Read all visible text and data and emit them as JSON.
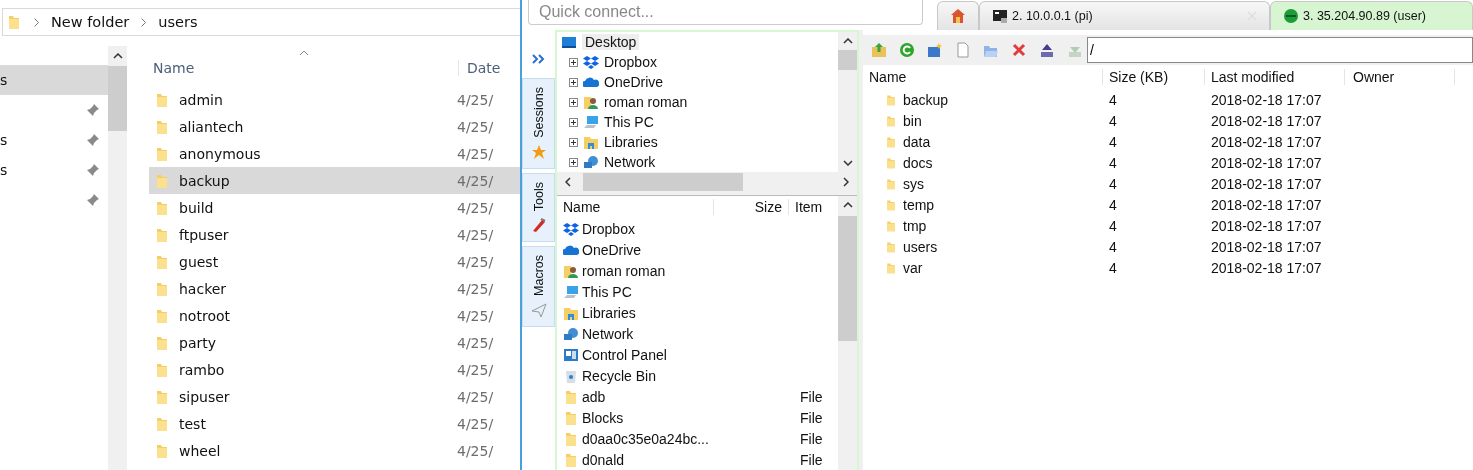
{
  "explorer": {
    "breadcrumb": [
      "New folder",
      "users"
    ],
    "nav_items": [
      {
        "label": "s",
        "selected": true,
        "pinned": false
      },
      {
        "selected": false,
        "pinned": true
      },
      {
        "label": "s",
        "selected": false,
        "pinned": true
      },
      {
        "label": "s",
        "selected": false,
        "pinned": true
      },
      {
        "selected": false,
        "pinned": true
      }
    ],
    "columns": [
      "Name",
      "Date"
    ],
    "rows": [
      {
        "name": "admin",
        "date": "4/25/",
        "selected": false
      },
      {
        "name": "aliantech",
        "date": "4/25/",
        "selected": false
      },
      {
        "name": "anonymous",
        "date": "4/25/",
        "selected": false
      },
      {
        "name": "backup",
        "date": "4/25/",
        "selected": true
      },
      {
        "name": "build",
        "date": "4/25/",
        "selected": false
      },
      {
        "name": "ftpuser",
        "date": "4/25/",
        "selected": false
      },
      {
        "name": "guest",
        "date": "4/25/",
        "selected": false
      },
      {
        "name": "hacker",
        "date": "4/25/",
        "selected": false
      },
      {
        "name": "notroot",
        "date": "4/25/",
        "selected": false
      },
      {
        "name": "party",
        "date": "4/25/",
        "selected": false
      },
      {
        "name": "rambo",
        "date": "4/25/",
        "selected": false
      },
      {
        "name": "sipuser",
        "date": "4/25/",
        "selected": false
      },
      {
        "name": "test",
        "date": "4/25/",
        "selected": false
      },
      {
        "name": "wheel",
        "date": "4/25/",
        "selected": false
      }
    ]
  },
  "mobaxterm": {
    "quick_connect": {
      "placeholder": "Quick connect..."
    },
    "tabs": [
      {
        "kind": "home",
        "selected": false,
        "closable": false
      },
      {
        "kind": "terminal",
        "label": "2. 10.0.0.1 (pi)",
        "selected": false,
        "closable": true
      },
      {
        "kind": "ssh",
        "label": "3. 35.204.90.89 (user)",
        "selected": true,
        "closable": false
      }
    ],
    "side_tabs": [
      {
        "label": "Sessions",
        "kind": "star"
      },
      {
        "label": "Tools",
        "kind": "tools"
      },
      {
        "label": "Macros",
        "kind": "plane"
      }
    ],
    "tree": {
      "label": "Desktop",
      "kind": "desktop",
      "selected": true,
      "children": [
        {
          "label": "Dropbox",
          "kind": "dropbox",
          "expanded": false
        },
        {
          "label": "OneDrive",
          "kind": "onedrive",
          "expanded": false
        },
        {
          "label": "roman roman",
          "kind": "user",
          "expanded": false
        },
        {
          "label": "This PC",
          "kind": "pc",
          "expanded": false
        },
        {
          "label": "Libraries",
          "kind": "libraries",
          "expanded": false
        },
        {
          "label": "Network",
          "kind": "network",
          "expanded": false
        }
      ]
    },
    "local_columns": [
      "Name",
      "Size",
      "Item"
    ],
    "local_rows": [
      {
        "name": "Dropbox",
        "kind": "dropbox"
      },
      {
        "name": "OneDrive",
        "kind": "onedrive"
      },
      {
        "name": "roman roman",
        "kind": "user"
      },
      {
        "name": "This PC",
        "kind": "pc"
      },
      {
        "name": "Libraries",
        "kind": "libraries"
      },
      {
        "name": "Network",
        "kind": "network"
      },
      {
        "name": "Control Panel",
        "kind": "control"
      },
      {
        "name": "Recycle Bin",
        "kind": "recycle"
      },
      {
        "name": "adb",
        "kind": "folder",
        "type": "File"
      },
      {
        "name": "Blocks",
        "kind": "folder",
        "type": "File"
      },
      {
        "name": "d0aa0c35e0a24bc...",
        "kind": "folder",
        "type": "File"
      },
      {
        "name": "d0nald",
        "kind": "folder",
        "type": "File"
      }
    ],
    "toolbar": [
      {
        "kind": "up",
        "disabled": false
      },
      {
        "kind": "refresh",
        "disabled": false
      },
      {
        "kind": "new-folder",
        "disabled": false
      },
      {
        "kind": "new-file",
        "disabled": false
      },
      {
        "kind": "open",
        "disabled": false
      },
      {
        "kind": "delete",
        "disabled": false
      },
      {
        "kind": "upload",
        "disabled": false
      },
      {
        "kind": "download",
        "disabled": true
      }
    ],
    "remote_path": "/",
    "remote_columns": [
      "Name",
      "Size (KB)",
      "Last modified",
      "Owner"
    ],
    "remote_rows": [
      {
        "name": "backup",
        "size": "4",
        "modified": "2018-02-18 17:07"
      },
      {
        "name": "bin",
        "size": "4",
        "modified": "2018-02-18 17:07"
      },
      {
        "name": "data",
        "size": "4",
        "modified": "2018-02-18 17:07"
      },
      {
        "name": "docs",
        "size": "4",
        "modified": "2018-02-18 17:07"
      },
      {
        "name": "sys",
        "size": "4",
        "modified": "2018-02-18 17:07"
      },
      {
        "name": "temp",
        "size": "4",
        "modified": "2018-02-18 17:07"
      },
      {
        "name": "tmp",
        "size": "4",
        "modified": "2018-02-18 17:07"
      },
      {
        "name": "users",
        "size": "4",
        "modified": "2018-02-18 17:07"
      },
      {
        "name": "var",
        "size": "4",
        "modified": "2018-02-18 17:07"
      }
    ]
  }
}
